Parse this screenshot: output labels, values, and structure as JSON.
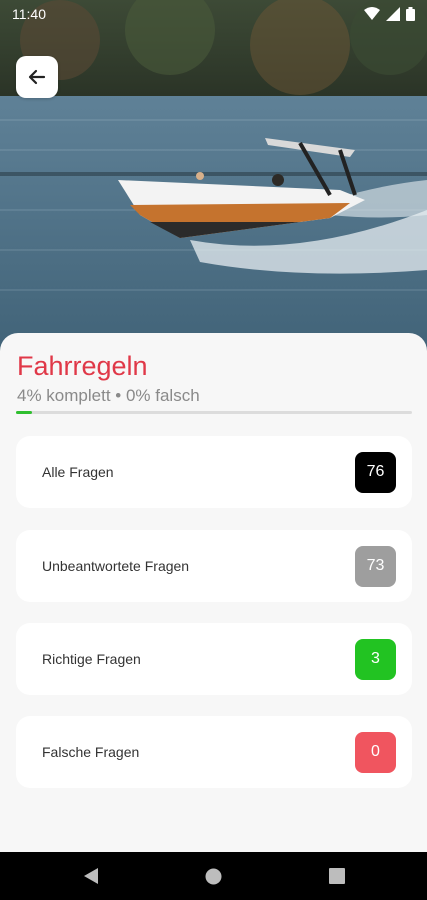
{
  "status": {
    "time": "11:40"
  },
  "header": {
    "back_icon": "arrow-left-icon"
  },
  "topic": {
    "title": "Fahrregeln",
    "summary": "4% komplett • 0% falsch",
    "progress_complete": 0.04
  },
  "categories": [
    {
      "label": "Alle Fragen",
      "count": "76",
      "color": "#000000"
    },
    {
      "label": "Unbeantwortete Fragen",
      "count": "73",
      "color": "#9e9e9e"
    },
    {
      "label": "Richtige Fragen",
      "count": "3",
      "color": "#22c322"
    },
    {
      "label": "Falsche Fragen",
      "count": "0",
      "color": "#f0555f"
    }
  ],
  "colors": {
    "accent": "#e03848",
    "progress": "#2fbf2f"
  },
  "navigation": {
    "back": "back-triangle-icon",
    "home": "home-circle-icon",
    "recents": "recents-square-icon"
  }
}
